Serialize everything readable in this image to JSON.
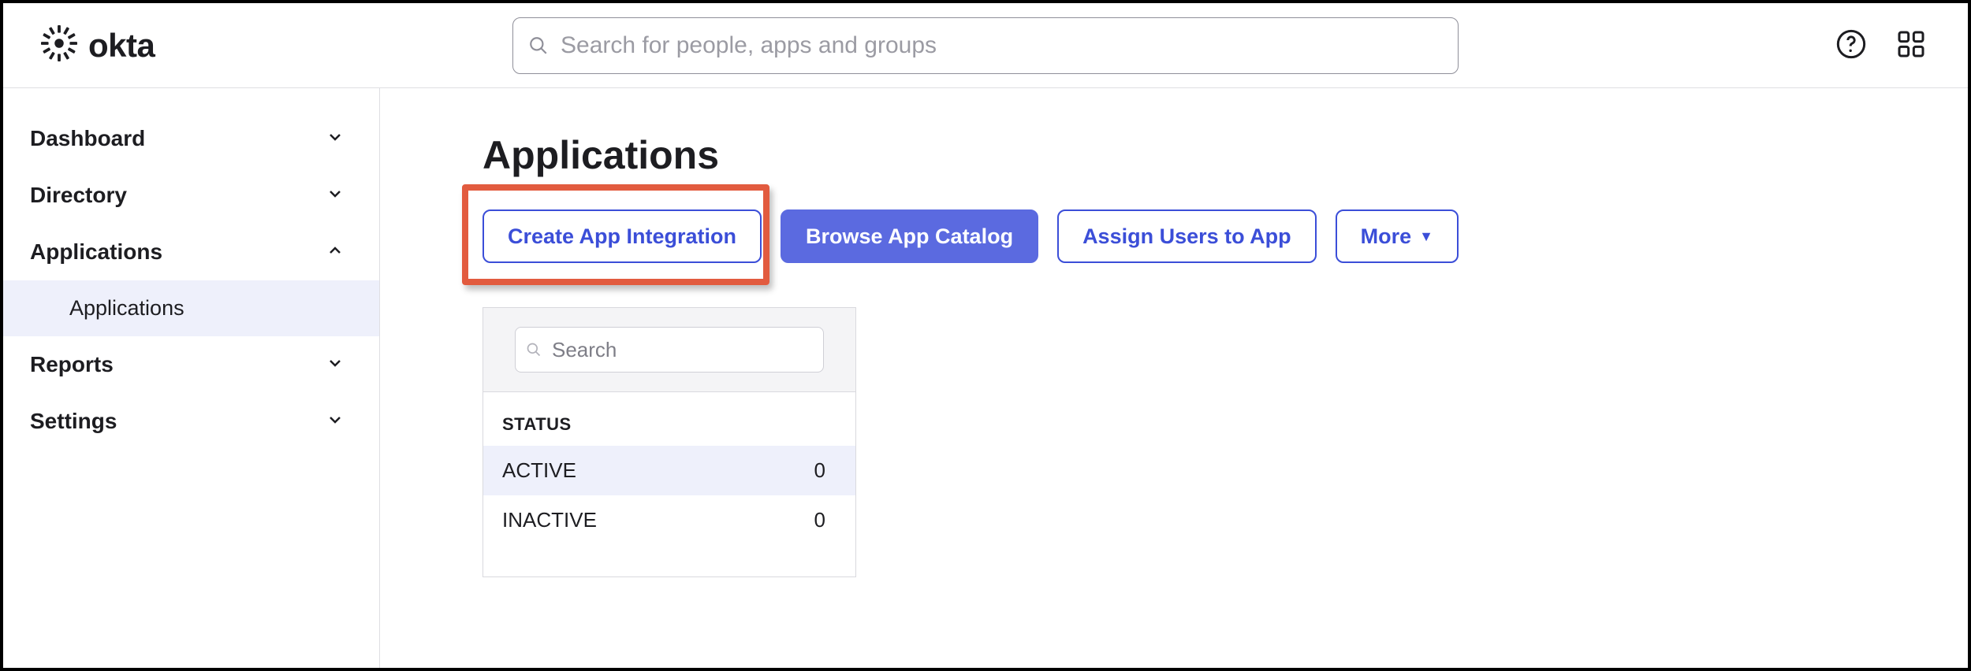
{
  "brand": {
    "name": "okta"
  },
  "search": {
    "placeholder": "Search for people, apps and groups"
  },
  "sidebar": {
    "items": [
      {
        "label": "Dashboard",
        "expanded": false
      },
      {
        "label": "Directory",
        "expanded": false
      },
      {
        "label": "Applications",
        "expanded": true,
        "children": [
          {
            "label": "Applications",
            "selected": true
          }
        ]
      },
      {
        "label": "Reports",
        "expanded": false
      },
      {
        "label": "Settings",
        "expanded": false
      }
    ]
  },
  "page": {
    "title": "Applications",
    "buttons": {
      "create": "Create App Integration",
      "browse": "Browse App Catalog",
      "assign": "Assign Users to App",
      "more": "More"
    },
    "panel": {
      "search_placeholder": "Search",
      "status_header": "STATUS",
      "statuses": [
        {
          "label": "ACTIVE",
          "count": 0,
          "selected": true
        },
        {
          "label": "INACTIVE",
          "count": 0,
          "selected": false
        }
      ]
    }
  }
}
